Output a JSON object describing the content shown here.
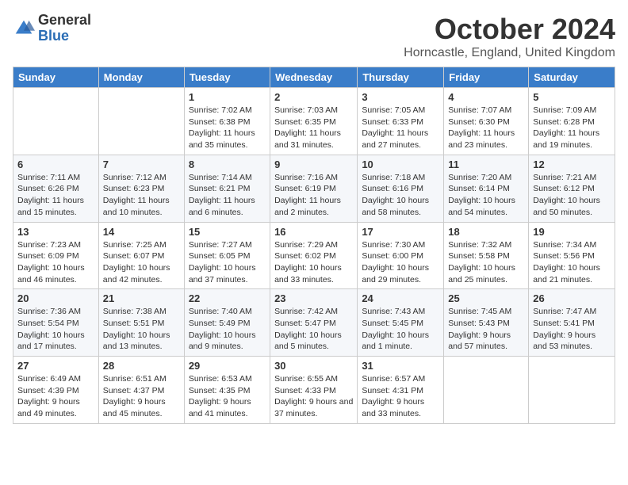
{
  "logo": {
    "general": "General",
    "blue": "Blue"
  },
  "title": "October 2024",
  "location": "Horncastle, England, United Kingdom",
  "days_of_week": [
    "Sunday",
    "Monday",
    "Tuesday",
    "Wednesday",
    "Thursday",
    "Friday",
    "Saturday"
  ],
  "weeks": [
    [
      null,
      null,
      {
        "day": "1",
        "sunrise": "7:02 AM",
        "sunset": "6:38 PM",
        "daylight": "11 hours and 35 minutes."
      },
      {
        "day": "2",
        "sunrise": "7:03 AM",
        "sunset": "6:35 PM",
        "daylight": "11 hours and 31 minutes."
      },
      {
        "day": "3",
        "sunrise": "7:05 AM",
        "sunset": "6:33 PM",
        "daylight": "11 hours and 27 minutes."
      },
      {
        "day": "4",
        "sunrise": "7:07 AM",
        "sunset": "6:30 PM",
        "daylight": "11 hours and 23 minutes."
      },
      {
        "day": "5",
        "sunrise": "7:09 AM",
        "sunset": "6:28 PM",
        "daylight": "11 hours and 19 minutes."
      }
    ],
    [
      {
        "day": "6",
        "sunrise": "7:11 AM",
        "sunset": "6:26 PM",
        "daylight": "11 hours and 15 minutes."
      },
      {
        "day": "7",
        "sunrise": "7:12 AM",
        "sunset": "6:23 PM",
        "daylight": "11 hours and 10 minutes."
      },
      {
        "day": "8",
        "sunrise": "7:14 AM",
        "sunset": "6:21 PM",
        "daylight": "11 hours and 6 minutes."
      },
      {
        "day": "9",
        "sunrise": "7:16 AM",
        "sunset": "6:19 PM",
        "daylight": "11 hours and 2 minutes."
      },
      {
        "day": "10",
        "sunrise": "7:18 AM",
        "sunset": "6:16 PM",
        "daylight": "10 hours and 58 minutes."
      },
      {
        "day": "11",
        "sunrise": "7:20 AM",
        "sunset": "6:14 PM",
        "daylight": "10 hours and 54 minutes."
      },
      {
        "day": "12",
        "sunrise": "7:21 AM",
        "sunset": "6:12 PM",
        "daylight": "10 hours and 50 minutes."
      }
    ],
    [
      {
        "day": "13",
        "sunrise": "7:23 AM",
        "sunset": "6:09 PM",
        "daylight": "10 hours and 46 minutes."
      },
      {
        "day": "14",
        "sunrise": "7:25 AM",
        "sunset": "6:07 PM",
        "daylight": "10 hours and 42 minutes."
      },
      {
        "day": "15",
        "sunrise": "7:27 AM",
        "sunset": "6:05 PM",
        "daylight": "10 hours and 37 minutes."
      },
      {
        "day": "16",
        "sunrise": "7:29 AM",
        "sunset": "6:02 PM",
        "daylight": "10 hours and 33 minutes."
      },
      {
        "day": "17",
        "sunrise": "7:30 AM",
        "sunset": "6:00 PM",
        "daylight": "10 hours and 29 minutes."
      },
      {
        "day": "18",
        "sunrise": "7:32 AM",
        "sunset": "5:58 PM",
        "daylight": "10 hours and 25 minutes."
      },
      {
        "day": "19",
        "sunrise": "7:34 AM",
        "sunset": "5:56 PM",
        "daylight": "10 hours and 21 minutes."
      }
    ],
    [
      {
        "day": "20",
        "sunrise": "7:36 AM",
        "sunset": "5:54 PM",
        "daylight": "10 hours and 17 minutes."
      },
      {
        "day": "21",
        "sunrise": "7:38 AM",
        "sunset": "5:51 PM",
        "daylight": "10 hours and 13 minutes."
      },
      {
        "day": "22",
        "sunrise": "7:40 AM",
        "sunset": "5:49 PM",
        "daylight": "10 hours and 9 minutes."
      },
      {
        "day": "23",
        "sunrise": "7:42 AM",
        "sunset": "5:47 PM",
        "daylight": "10 hours and 5 minutes."
      },
      {
        "day": "24",
        "sunrise": "7:43 AM",
        "sunset": "5:45 PM",
        "daylight": "10 hours and 1 minute."
      },
      {
        "day": "25",
        "sunrise": "7:45 AM",
        "sunset": "5:43 PM",
        "daylight": "9 hours and 57 minutes."
      },
      {
        "day": "26",
        "sunrise": "7:47 AM",
        "sunset": "5:41 PM",
        "daylight": "9 hours and 53 minutes."
      }
    ],
    [
      {
        "day": "27",
        "sunrise": "6:49 AM",
        "sunset": "4:39 PM",
        "daylight": "9 hours and 49 minutes."
      },
      {
        "day": "28",
        "sunrise": "6:51 AM",
        "sunset": "4:37 PM",
        "daylight": "9 hours and 45 minutes."
      },
      {
        "day": "29",
        "sunrise": "6:53 AM",
        "sunset": "4:35 PM",
        "daylight": "9 hours and 41 minutes."
      },
      {
        "day": "30",
        "sunrise": "6:55 AM",
        "sunset": "4:33 PM",
        "daylight": "9 hours and 37 minutes."
      },
      {
        "day": "31",
        "sunrise": "6:57 AM",
        "sunset": "4:31 PM",
        "daylight": "9 hours and 33 minutes."
      },
      null,
      null
    ]
  ]
}
